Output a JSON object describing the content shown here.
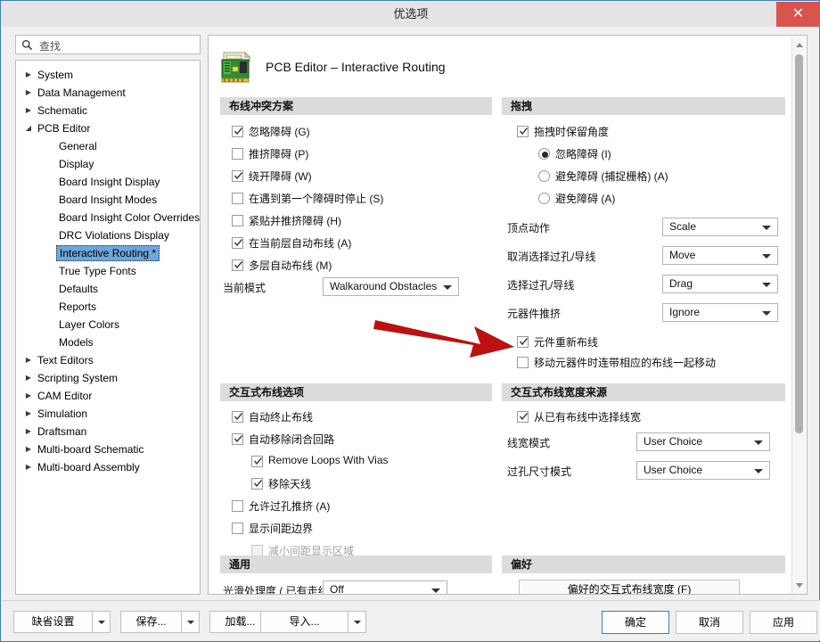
{
  "window": {
    "title": "优选项",
    "close_label": "✕"
  },
  "search": {
    "placeholder": "查找",
    "icon": "search-icon"
  },
  "sidebar": {
    "items": [
      {
        "label": "System",
        "level": 0,
        "arrow": "▶",
        "selected": false
      },
      {
        "label": "Data Management",
        "level": 0,
        "arrow": "▶",
        "selected": false
      },
      {
        "label": "Schematic",
        "level": 0,
        "arrow": "▶",
        "selected": false
      },
      {
        "label": "PCB Editor",
        "level": 0,
        "arrow": "◢",
        "selected": false
      },
      {
        "label": "General",
        "level": 1,
        "arrow": "",
        "selected": false
      },
      {
        "label": "Display",
        "level": 1,
        "arrow": "",
        "selected": false
      },
      {
        "label": "Board Insight Display",
        "level": 1,
        "arrow": "",
        "selected": false
      },
      {
        "label": "Board Insight Modes",
        "level": 1,
        "arrow": "",
        "selected": false
      },
      {
        "label": "Board Insight Color Overrides",
        "level": 1,
        "arrow": "",
        "selected": false
      },
      {
        "label": "DRC Violations Display",
        "level": 1,
        "arrow": "",
        "selected": false
      },
      {
        "label": "Interactive Routing *",
        "level": 1,
        "arrow": "",
        "selected": true
      },
      {
        "label": "True Type Fonts",
        "level": 1,
        "arrow": "",
        "selected": false
      },
      {
        "label": "Defaults",
        "level": 1,
        "arrow": "",
        "selected": false
      },
      {
        "label": "Reports",
        "level": 1,
        "arrow": "",
        "selected": false
      },
      {
        "label": "Layer Colors",
        "level": 1,
        "arrow": "",
        "selected": false
      },
      {
        "label": "Models",
        "level": 1,
        "arrow": "",
        "selected": false
      },
      {
        "label": "Text Editors",
        "level": 0,
        "arrow": "▶",
        "selected": false
      },
      {
        "label": "Scripting System",
        "level": 0,
        "arrow": "▶",
        "selected": false
      },
      {
        "label": "CAM Editor",
        "level": 0,
        "arrow": "▶",
        "selected": false
      },
      {
        "label": "Simulation",
        "level": 0,
        "arrow": "▶",
        "selected": false
      },
      {
        "label": "Draftsman",
        "level": 0,
        "arrow": "▶",
        "selected": false
      },
      {
        "label": "Multi-board Schematic",
        "level": 0,
        "arrow": "▶",
        "selected": false
      },
      {
        "label": "Multi-board Assembly",
        "level": 0,
        "arrow": "▶",
        "selected": false
      }
    ]
  },
  "page": {
    "heading": "PCB Editor – Interactive Routing",
    "icon": "pcb-board-icon"
  },
  "sections": {
    "routing_conflict": {
      "title": "布线冲突方案",
      "options": [
        {
          "label": "忽略障碍 (G)",
          "checked": true
        },
        {
          "label": "推挤障碍 (P)",
          "checked": false
        },
        {
          "label": "绕开障碍 (W)",
          "checked": true
        },
        {
          "label": "在遇到第一个障碍时停止 (S)",
          "checked": false
        },
        {
          "label": "紧贴并推挤障碍 (H)",
          "checked": false
        },
        {
          "label": "在当前层自动布线 (A)",
          "checked": true
        },
        {
          "label": "多层自动布线 (M)",
          "checked": true
        }
      ],
      "current_mode_label": "当前模式",
      "current_mode_value": "Walkaround Obstacles"
    },
    "drag": {
      "title": "拖拽",
      "preserve_angle_label": "拖拽时保留角度",
      "preserve_angle_checked": true,
      "radios": [
        {
          "label": "忽略障碍 (I)",
          "selected": true
        },
        {
          "label": "避免障碍 (捕捉栅格) (A)",
          "selected": false
        },
        {
          "label": "避免障碍 (A)",
          "selected": false
        }
      ],
      "fields": [
        {
          "label": "顶点动作",
          "value": "Scale"
        },
        {
          "label": "取消选择过孔/导线",
          "value": "Move"
        },
        {
          "label": "选择过孔/导线",
          "value": "Drag"
        },
        {
          "label": "元器件推挤",
          "value": "Ignore"
        }
      ],
      "checks": [
        {
          "label": "元件重新布线",
          "checked": true
        },
        {
          "label": "移动元器件时连带相应的布线一起移动",
          "checked": false
        }
      ]
    },
    "interactive_routing_options": {
      "title": "交互式布线选项",
      "options": [
        {
          "label": "自动终止布线",
          "checked": true,
          "indent": 0,
          "disabled": false
        },
        {
          "label": "自动移除闭合回路",
          "checked": true,
          "indent": 0,
          "disabled": false
        },
        {
          "label": "Remove Loops With Vias",
          "checked": true,
          "indent": 1,
          "disabled": false
        },
        {
          "label": "移除天线",
          "checked": true,
          "indent": 1,
          "disabled": false
        },
        {
          "label": "允许过孔推挤 (A)",
          "checked": false,
          "indent": 0,
          "disabled": false
        },
        {
          "label": "显示间距边界",
          "checked": false,
          "indent": 0,
          "disabled": false
        },
        {
          "label": "减小间距显示区域",
          "checked": false,
          "indent": 1,
          "disabled": true
        }
      ]
    },
    "width_source": {
      "title": "交互式布线宽度来源",
      "check": {
        "label": "从已有布线中选择线宽",
        "checked": true
      },
      "fields": [
        {
          "label": "线宽模式",
          "value": "User Choice"
        },
        {
          "label": "过孔尺寸模式",
          "value": "User Choice"
        }
      ]
    },
    "general": {
      "title": "通用",
      "smooth_label": "光滑处理度 ( 已有走线",
      "smooth_value": "Off"
    },
    "preference": {
      "title": "偏好",
      "button_label": "偏好的交互式布线宽度 (F)"
    }
  },
  "footer": {
    "default_settings": "缺省设置",
    "save": "保存...",
    "load": "加载...",
    "import": "导入...",
    "ok": "确定",
    "cancel": "取消",
    "apply": "应用"
  },
  "colors": {
    "accent": "#3a7dbd",
    "close": "#d9534f",
    "selection": "#6ca6dd",
    "section_band": "#dcdcdc",
    "annotation_arrow": "#bb1111"
  }
}
